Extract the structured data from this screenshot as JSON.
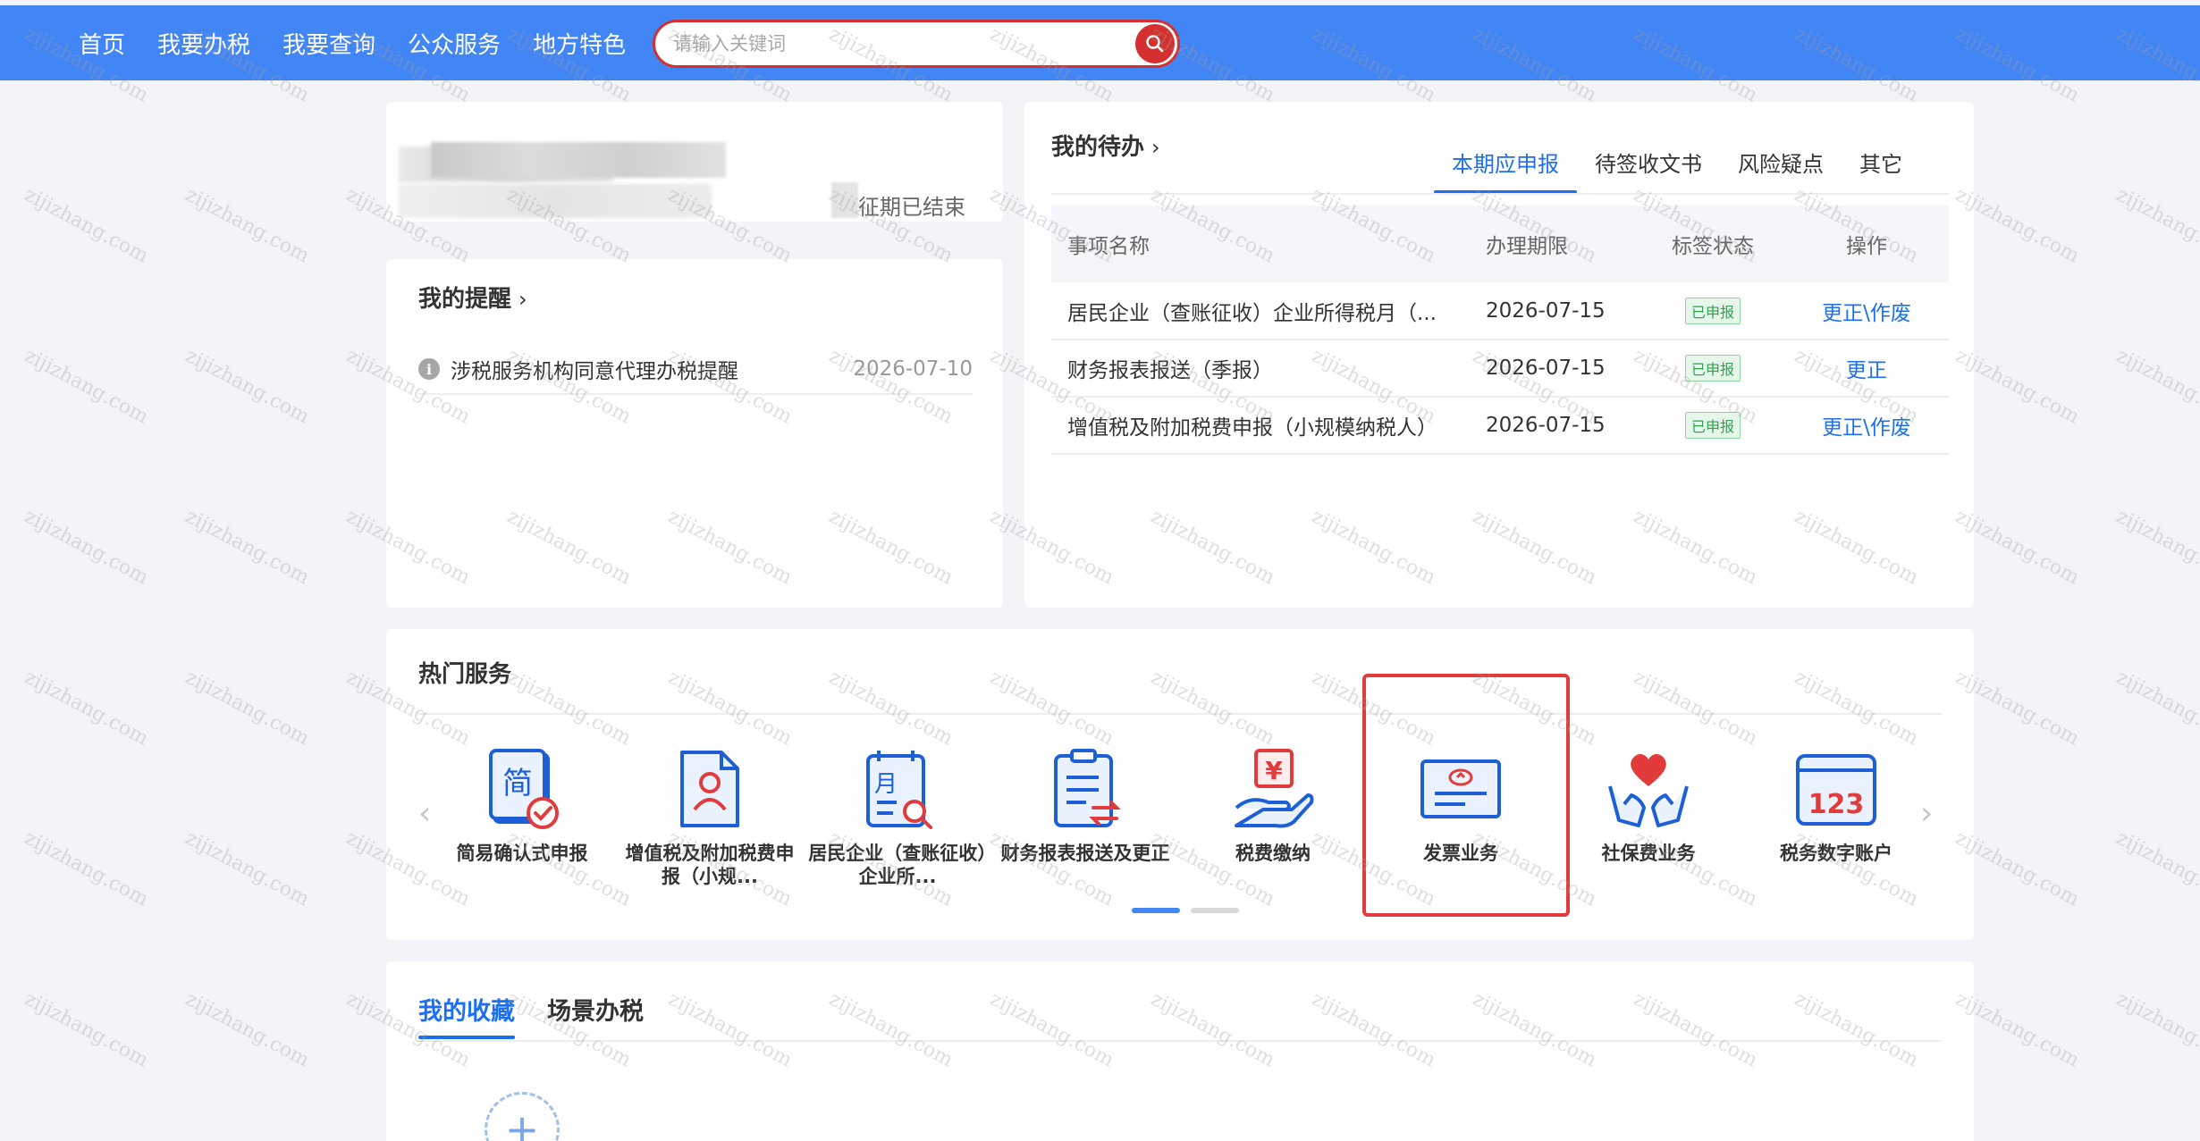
{
  "nav": {
    "items": [
      "首页",
      "我要办税",
      "我要查询",
      "公众服务",
      "地方特色"
    ]
  },
  "search": {
    "placeholder": "请输入关键词"
  },
  "user_card": {
    "period_status": "征期已结束"
  },
  "reminders": {
    "title": "我的提醒",
    "items": [
      {
        "text": "涉税服务机构同意代理办税提醒",
        "date": "2026-07-10"
      }
    ]
  },
  "todo": {
    "title": "我的待办",
    "tabs": [
      "本期应申报",
      "待签收文书",
      "风险疑点",
      "其它"
    ],
    "columns": [
      "事项名称",
      "办理期限",
      "标签状态",
      "操作"
    ],
    "rows": [
      {
        "name": "居民企业（查账征收）企业所得税月（...",
        "deadline": "2026-07-15",
        "status": "已申报",
        "action": "更正\\作废"
      },
      {
        "name": "财务报表报送（季报）",
        "deadline": "2026-07-15",
        "status": "已申报",
        "action": "更正"
      },
      {
        "name": "增值税及附加税费申报（小规模纳税人）",
        "deadline": "2026-07-15",
        "status": "已申报",
        "action": "更正\\作废"
      }
    ]
  },
  "hot_services": {
    "title": "热门服务",
    "items": [
      {
        "label": "简易确认式申报",
        "icon": "simple-declare-icon"
      },
      {
        "label": "增值税及附加税费申报（小规...",
        "icon": "vat-declare-icon"
      },
      {
        "label": "居民企业（查账征收）企业所...",
        "icon": "enterprise-income-icon"
      },
      {
        "label": "财务报表报送及更正",
        "icon": "financial-report-icon"
      },
      {
        "label": "税费缴纳",
        "icon": "tax-payment-icon"
      },
      {
        "label": "发票业务",
        "icon": "invoice-icon"
      },
      {
        "label": "社保费业务",
        "icon": "social-security-icon"
      },
      {
        "label": "税务数字账户",
        "icon": "digital-account-icon"
      }
    ],
    "icon_digits": "123",
    "icon_char_jian": "简",
    "icon_char_yue": "月",
    "icon_char_yen": "¥"
  },
  "favorites": {
    "tabs": [
      "我的收藏",
      "场景办税"
    ]
  },
  "watermark": "zijizhang.com",
  "colors": {
    "nav_bg": "#4285f4",
    "accent": "#1d6ff1",
    "search_red": "#d3302f",
    "highlight_red": "#e23b3b"
  }
}
